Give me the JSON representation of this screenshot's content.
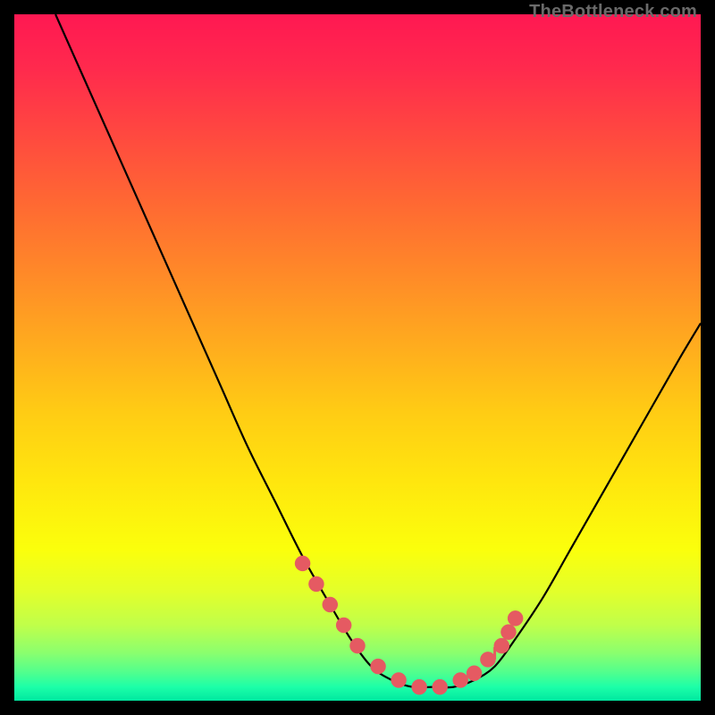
{
  "watermark": "TheBottleneck.com",
  "colors": {
    "marker": "#e55a62",
    "curve": "#000000",
    "bg_top": "#ff1852",
    "bg_bottom": "#00e8a0",
    "frame": "#000000"
  },
  "chart_data": {
    "type": "line",
    "title": "",
    "xlabel": "",
    "ylabel": "",
    "xlim": [
      0,
      100
    ],
    "ylim": [
      0,
      100
    ],
    "series": [
      {
        "name": "bottleneck-curve",
        "x": [
          6,
          10,
          14,
          18,
          22,
          26,
          30,
          34,
          38,
          42,
          46,
          49,
          52,
          55,
          58,
          61,
          64,
          67,
          70,
          73,
          77,
          81,
          85,
          89,
          93,
          97,
          100
        ],
        "y": [
          100,
          91,
          82,
          73,
          64,
          55,
          46,
          37,
          29,
          21,
          14,
          9,
          5,
          3,
          2,
          2,
          2,
          3,
          5,
          9,
          15,
          22,
          29,
          36,
          43,
          50,
          55
        ]
      }
    ],
    "markers": {
      "name": "highlight-points",
      "x": [
        42,
        44,
        46,
        48,
        50,
        53,
        56,
        59,
        62,
        65,
        67,
        69,
        71,
        72,
        73
      ],
      "y": [
        20,
        17,
        14,
        11,
        8,
        5,
        3,
        2,
        2,
        3,
        4,
        6,
        8,
        10,
        12
      ]
    },
    "ticks_up": {
      "x": [
        67,
        70,
        72
      ],
      "y": [
        3,
        6,
        9
      ]
    }
  }
}
